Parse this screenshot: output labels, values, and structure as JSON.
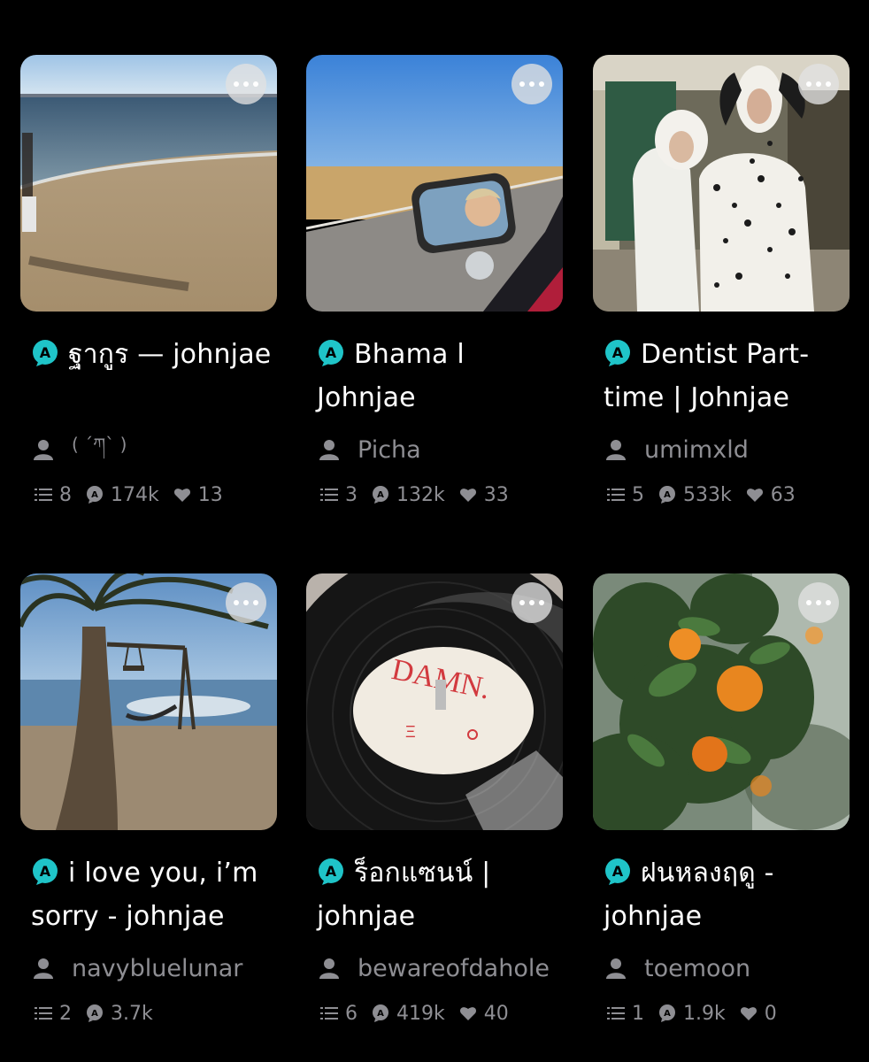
{
  "stories": [
    {
      "title": "ฐากูร — johnjae",
      "author": "( ´ཀ` )",
      "parts": "8",
      "reads": "174k",
      "likes": "13",
      "thumb": "beach"
    },
    {
      "title": "Bhama l Johnjae",
      "author": "Picha",
      "parts": "3",
      "reads": "132k",
      "likes": "33",
      "thumb": "car-mirror"
    },
    {
      "title": "Dentist Part-time | Johnjae",
      "author": "umimxld",
      "parts": "5",
      "reads": "533k",
      "likes": "63",
      "thumb": "dalmatian-costumes"
    },
    {
      "title": "i love you, i’m sorry - johnjae",
      "author": "navybluelunar",
      "parts": "2",
      "reads": "3.7k",
      "likes": "",
      "thumb": "palm-tree-swing"
    },
    {
      "title": "ร็อกแซนน์ | johnjae",
      "author": "bewareofdahole",
      "parts": "6",
      "reads": "419k",
      "likes": "40",
      "thumb": "vinyl-record"
    },
    {
      "title": "ฝนหลงฤดู - johnjae",
      "author": "toemoon",
      "parts": "1",
      "reads": "1.9k",
      "likes": "0",
      "thumb": "orange-tree"
    }
  ],
  "colors": {
    "badge": "#1fc4c8",
    "muted_text": "#8e8e93",
    "background": "#000000"
  },
  "icons": {
    "more": "more-dots-icon",
    "author": "person-icon",
    "parts": "list-icon",
    "reads": "read-count-icon",
    "likes": "heart-icon",
    "story_badge": "a-badge-icon"
  }
}
